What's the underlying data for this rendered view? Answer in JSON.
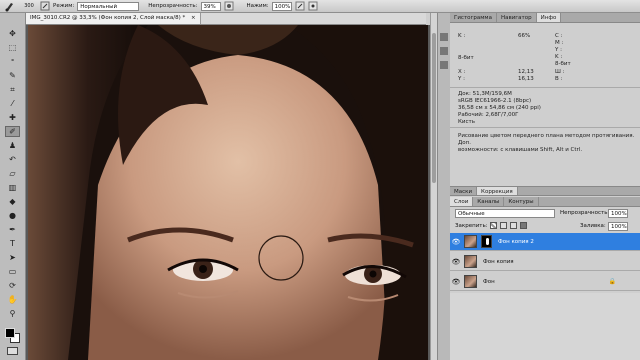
{
  "options_bar": {
    "brush_size": "300",
    "mode_label": "Режим:",
    "mode_value": "Нормальный",
    "opacity_label": "Непрозрачность:",
    "opacity_value": "39%",
    "flow_label": "Нажим:",
    "flow_value": "100%"
  },
  "document": {
    "tab_title": "IMG_3010.CR2 @ 33,3% (Фон копия 2, Слой маска/8) *",
    "close_glyph": "×"
  },
  "info_panel": {
    "tabs": [
      "Гистограмма",
      "Навигатор",
      "Инфо"
    ],
    "active_tab": "Инфо",
    "k_label": "K :",
    "k_value": "66%",
    "bit_left": "8-бит",
    "c_label": "C :",
    "m_label": "M :",
    "y_label": "Y :",
    "k2_label": "K :",
    "bit_right": "8-бит",
    "x_label": "X :",
    "x_value": "12,13",
    "y_label2": "Y :",
    "y_value": "16,13",
    "w_label": "Ш :",
    "h_label": "В :",
    "doc_line": "Док: 51,3M/159,6M",
    "profile_line": "sRGB IEC61966-2.1 (8bpc)",
    "size_line": "36,58 см x 54,86 см (240 ppi)",
    "work_line": "Рабочий: 2,68Г/7,00Г",
    "tool_line": "Кисть",
    "hint_line1": "Рисование цветом переднего плана методом протягивания. Доп.",
    "hint_line2": "возможности: с клавишами Shift, Alt и Ctrl."
  },
  "adjust_panel": {
    "tabs": [
      "Маски",
      "Коррекция"
    ]
  },
  "layers_panel": {
    "tabs": [
      "Слои",
      "Каналы",
      "Контуры"
    ],
    "blend_mode": "Обычные",
    "opacity_label": "Непрозрачность:",
    "opacity_value": "100%",
    "lock_label": "Закрепить:",
    "fill_label": "Заливка:",
    "fill_value": "100%",
    "layers": [
      {
        "name": "Фон копия 2",
        "selected": true
      },
      {
        "name": "Фон копия",
        "selected": false
      },
      {
        "name": "Фон",
        "selected": false,
        "locked": true
      }
    ]
  },
  "colors": {
    "selection": "#2f7fe0",
    "panel_bg": "#cfcfcf"
  },
  "icons": {
    "eye": "eye-icon",
    "lock": "lock-icon",
    "brush": "brush-icon"
  }
}
